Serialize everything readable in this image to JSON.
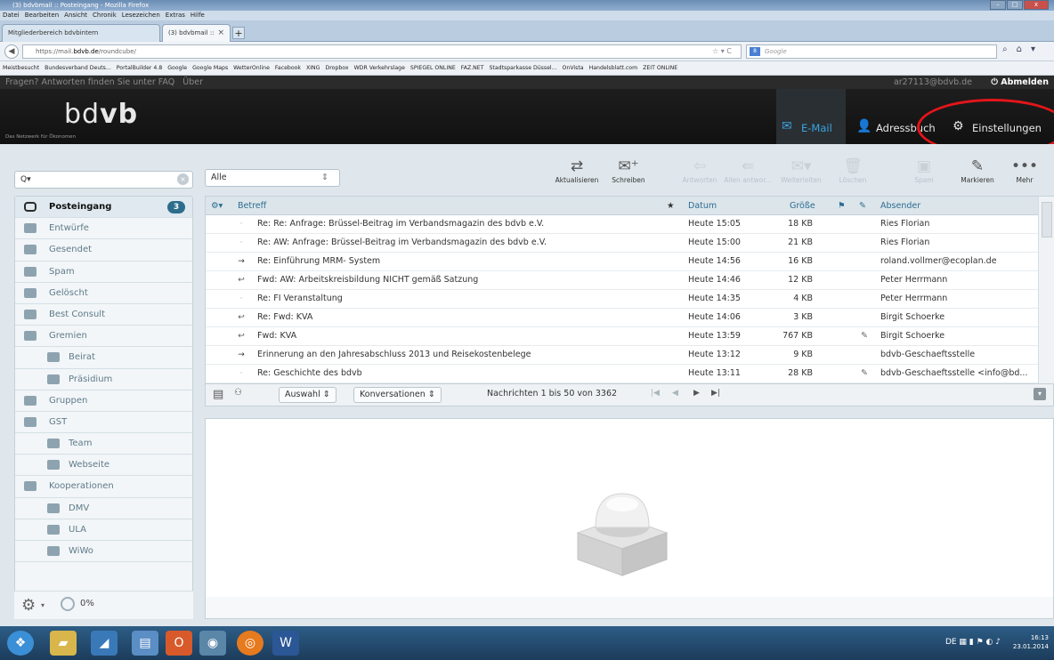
{
  "window": {
    "title": "(3) bdvbmail :: Posteingang - Mozilla Firefox",
    "menu": [
      "Datei",
      "Bearbeiten",
      "Ansicht",
      "Chronik",
      "Lesezeichen",
      "Extras",
      "Hilfe"
    ],
    "tabs": [
      {
        "label": "Mitgliederbereich bdvbintern"
      },
      {
        "label": "(3) bdvbmail :: Posteingang"
      }
    ],
    "url_prefix": "https://mail.",
    "url_domain": "bdvb.de",
    "url_path": "/roundcube/",
    "search_placeholder": "Google",
    "bookmarks": [
      "Meistbesucht",
      "Bundesverband Deuts...",
      "PortalBuilder 4.8",
      "Google",
      "Google Maps",
      "WetterOnline",
      "Facebook",
      "XING",
      "Dropbox",
      "WDR Verkehrslage",
      "SPIEGEL ONLINE",
      "FAZ.NET",
      "Stadtsparkasse Düssel...",
      "OnVista",
      "Handelsblatt.com",
      "ZEIT ONLINE"
    ]
  },
  "topline": {
    "help_text": "Fragen? Antworten finden Sie unter FAQ",
    "about": "Über",
    "user": "ar27113@bdvb.de",
    "logout": "Abmelden"
  },
  "header": {
    "logo_light": "bd",
    "logo_bold": "vb",
    "tagline": "Das Netzwerk für Ökonomen",
    "nav": {
      "email": "E-Mail",
      "addressbook": "Adressbuch",
      "settings": "Einstellungen"
    }
  },
  "search": {
    "placeholder": "Q▾"
  },
  "filter": {
    "value": "Alle"
  },
  "toolbar": {
    "refresh": "Aktualisieren",
    "compose": "Schreiben",
    "reply": "Antworten",
    "reply_all": "Allen antwor...",
    "forward": "Weiterleiten",
    "delete": "Löschen",
    "spam": "Spam",
    "mark": "Markieren",
    "more": "Mehr"
  },
  "folders": [
    {
      "name": "Posteingang",
      "selected": true,
      "badge": "3",
      "sub": false
    },
    {
      "name": "Entwürfe",
      "sub": false
    },
    {
      "name": "Gesendet",
      "sub": false
    },
    {
      "name": "Spam",
      "sub": false
    },
    {
      "name": "Gelöscht",
      "sub": false
    },
    {
      "name": "Best Consult",
      "sub": false
    },
    {
      "name": "Gremien",
      "sub": false
    },
    {
      "name": "Beirat",
      "sub": true
    },
    {
      "name": "Präsidium",
      "sub": true
    },
    {
      "name": "Gruppen",
      "sub": false
    },
    {
      "name": "GST",
      "sub": false
    },
    {
      "name": "Team",
      "sub": true
    },
    {
      "name": "Webseite",
      "sub": true
    },
    {
      "name": "Kooperationen",
      "sub": false
    },
    {
      "name": "DMV",
      "sub": true
    },
    {
      "name": "ULA",
      "sub": true
    },
    {
      "name": "WiWo",
      "sub": true
    }
  ],
  "quota": "0%",
  "list_header": {
    "subject": "Betreff",
    "date": "Datum",
    "size": "Größe",
    "from": "Absender"
  },
  "messages": [
    {
      "icon": "·",
      "subject": "Re: Re: Anfrage: Brüssel-Beitrag im Verbandsmagazin des bdvb e.V.",
      "date": "Heute 15:05",
      "size": "18 KB",
      "attach": "",
      "from": "Ries Florian"
    },
    {
      "icon": "·",
      "subject": "Re: AW: Anfrage: Brüssel-Beitrag im Verbandsmagazin des bdvb e.V.",
      "date": "Heute 15:00",
      "size": "21 KB",
      "attach": "",
      "from": "Ries Florian"
    },
    {
      "icon": "→",
      "subject": "Re: Einführung MRM- System",
      "date": "Heute 14:56",
      "size": "16 KB",
      "attach": "",
      "from": "roland.vollmer@ecoplan.de"
    },
    {
      "icon": "↩",
      "subject": "Fwd: AW: Arbeitskreisbildung NICHT gemäß Satzung",
      "date": "Heute 14:46",
      "size": "12 KB",
      "attach": "",
      "from": "Peter Herrmann"
    },
    {
      "icon": "·",
      "subject": "Re: FI Veranstaltung",
      "date": "Heute 14:35",
      "size": "4 KB",
      "attach": "",
      "from": "Peter Herrmann"
    },
    {
      "icon": "↩",
      "subject": "Re: Fwd: KVA",
      "date": "Heute 14:06",
      "size": "3 KB",
      "attach": "",
      "from": "Birgit Schoerke"
    },
    {
      "icon": "↩",
      "subject": "Fwd: KVA",
      "date": "Heute 13:59",
      "size": "767 KB",
      "attach": "✎",
      "from": "Birgit Schoerke"
    },
    {
      "icon": "→",
      "subject": "Erinnerung an den Jahresabschluss 2013 und Reisekostenbelege",
      "date": "Heute 13:12",
      "size": "9 KB",
      "attach": "",
      "from": "bdvb-Geschaeftsstelle"
    },
    {
      "icon": "·",
      "subject": "Re: Geschichte des bdvb",
      "date": "Heute 13:11",
      "size": "28 KB",
      "attach": "✎",
      "from": "bdvb-Geschaeftsstelle <info@bd..."
    }
  ],
  "list_footer": {
    "selection": "Auswahl",
    "threads": "Konversationen",
    "count": "Nachrichten 1 bis 50 von 3362"
  },
  "taskbar": {
    "lang": "DE",
    "time": "16:13",
    "date": "23.01.2014"
  }
}
